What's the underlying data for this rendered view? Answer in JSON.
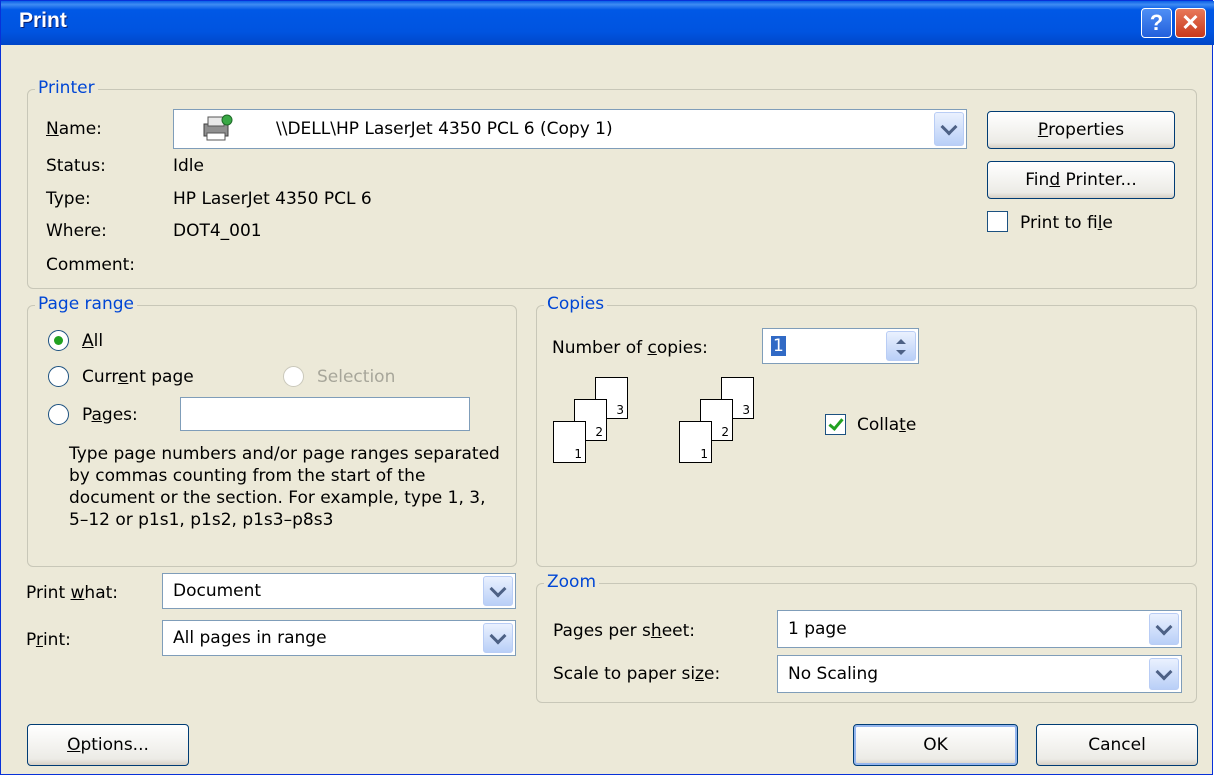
{
  "window": {
    "title": "Print",
    "help_label": "?",
    "close_label": "✕"
  },
  "printer": {
    "legend": "Printer",
    "name_label": "Name:",
    "name_value": "\\\\DELL\\HP LaserJet 4350 PCL 6 (Copy 1)",
    "status_label": "Status:",
    "status_value": "Idle",
    "type_label": "Type:",
    "type_value": "HP LaserJet 4350 PCL 6",
    "where_label": "Where:",
    "where_value": "DOT4_001",
    "comment_label": "Comment:",
    "comment_value": "",
    "properties_button": "Properties",
    "find_printer_button": "Find Printer...",
    "print_to_file_label": "Print to file",
    "print_to_file_checked": false
  },
  "page_range": {
    "legend": "Page range",
    "all_label": "All",
    "current_page_label": "Current page",
    "selection_label": "Selection",
    "pages_label": "Pages:",
    "pages_value": "",
    "selected": "All",
    "help_text": "Type page numbers and/or page ranges separated by commas counting from the start of the document or the section. For example, type 1, 3, 5–12 or p1s1, p1s2, p1s3–p8s3"
  },
  "copies": {
    "legend": "Copies",
    "number_label": "Number of copies:",
    "number_value": "1",
    "collate_label": "Collate",
    "collate_checked": true,
    "page_numbers": [
      "1",
      "2",
      "3"
    ]
  },
  "print_what": {
    "label": "Print what:",
    "value": "Document"
  },
  "print": {
    "label": "Print:",
    "value": "All pages in range"
  },
  "zoom": {
    "legend": "Zoom",
    "pages_per_sheet_label": "Pages per sheet:",
    "pages_per_sheet_value": "1 page",
    "scale_label": "Scale to paper size:",
    "scale_value": "No Scaling"
  },
  "footer": {
    "options_button": "Options...",
    "ok_button": "OK",
    "cancel_button": "Cancel"
  }
}
